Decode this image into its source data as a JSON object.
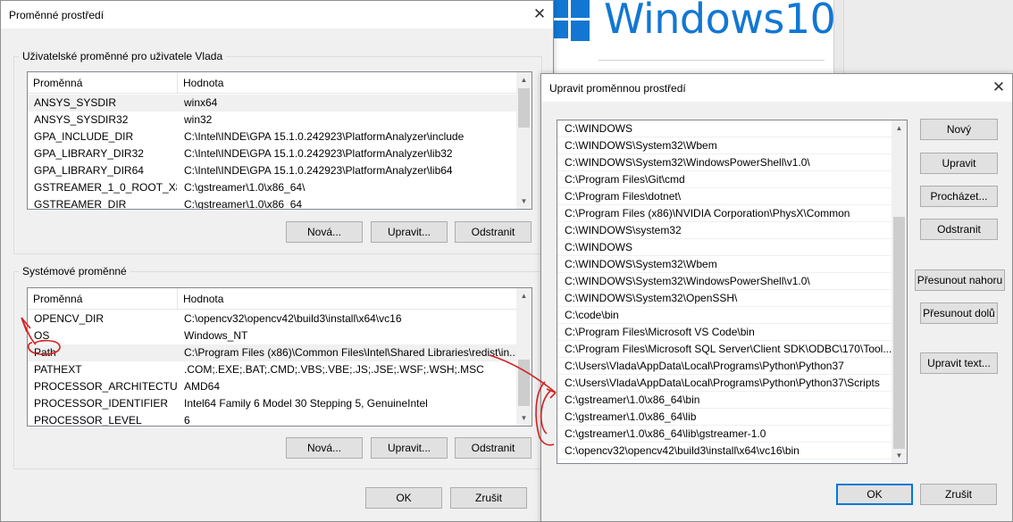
{
  "background": {
    "brand_text": "Windows",
    "brand_version": "10",
    "brand_color": "#1277d3"
  },
  "env_dialog": {
    "title": "Proměnné prostředí",
    "user_group_label": "Uživatelské proměnné pro uživatele Vlada",
    "user_columns": [
      "Proměnná",
      "Hodnota"
    ],
    "user_vars": [
      {
        "name": "ANSYS_SYSDIR",
        "value": "winx64"
      },
      {
        "name": "ANSYS_SYSDIR32",
        "value": "win32"
      },
      {
        "name": "GPA_INCLUDE_DIR",
        "value": "C:\\Intel\\INDE\\GPA 15.1.0.242923\\PlatformAnalyzer\\include"
      },
      {
        "name": "GPA_LIBRARY_DIR32",
        "value": "C:\\Intel\\INDE\\GPA 15.1.0.242923\\PlatformAnalyzer\\lib32"
      },
      {
        "name": "GPA_LIBRARY_DIR64",
        "value": "C:\\Intel\\INDE\\GPA 15.1.0.242923\\PlatformAnalyzer\\lib64"
      },
      {
        "name": "GSTREAMER_1_0_ROOT_X86...",
        "value": "C:\\gstreamer\\1.0\\x86_64\\"
      },
      {
        "name": "GSTREAMER_DIR",
        "value": "C:\\gstreamer\\1.0\\x86_64"
      }
    ],
    "user_buttons": {
      "new": "Nová...",
      "edit": "Upravit...",
      "delete": "Odstranit"
    },
    "system_group_label": "Systémové proměnné",
    "system_columns": [
      "Proměnná",
      "Hodnota"
    ],
    "system_vars": [
      {
        "name": "OPENCV_DIR",
        "value": "C:\\opencv32\\opencv42\\build3\\install\\x64\\vc16"
      },
      {
        "name": "OS",
        "value": "Windows_NT"
      },
      {
        "name": "Path",
        "value": "C:\\Program Files (x86)\\Common Files\\Intel\\Shared Libraries\\redist\\in..."
      },
      {
        "name": "PATHEXT",
        "value": ".COM;.EXE;.BAT;.CMD;.VBS;.VBE;.JS;.JSE;.WSF;.WSH;.MSC"
      },
      {
        "name": "PROCESSOR_ARCHITECTURE",
        "value": "AMD64"
      },
      {
        "name": "PROCESSOR_IDENTIFIER",
        "value": "Intel64 Family 6 Model 30 Stepping 5, GenuineIntel"
      },
      {
        "name": "PROCESSOR_LEVEL",
        "value": "6"
      }
    ],
    "system_buttons": {
      "new": "Nová...",
      "edit": "Upravit...",
      "delete": "Odstranit"
    },
    "ok": "OK",
    "cancel": "Zrušit"
  },
  "edit_dialog": {
    "title": "Upravit proměnnou prostředí",
    "entries": [
      "C:\\WINDOWS",
      "C:\\WINDOWS\\System32\\Wbem",
      "C:\\WINDOWS\\System32\\WindowsPowerShell\\v1.0\\",
      "C:\\Program Files\\Git\\cmd",
      "C:\\Program Files\\dotnet\\",
      "C:\\Program Files (x86)\\NVIDIA Corporation\\PhysX\\Common",
      "C:\\WINDOWS\\system32",
      "C:\\WINDOWS",
      "C:\\WINDOWS\\System32\\Wbem",
      "C:\\WINDOWS\\System32\\WindowsPowerShell\\v1.0\\",
      "C:\\WINDOWS\\System32\\OpenSSH\\",
      "C:\\code\\bin",
      "C:\\Program Files\\Microsoft VS Code\\bin",
      "C:\\Program Files\\Microsoft SQL Server\\Client SDK\\ODBC\\170\\Tool...",
      "C:\\Users\\Vlada\\AppData\\Local\\Programs\\Python\\Python37",
      "C:\\Users\\Vlada\\AppData\\Local\\Programs\\Python\\Python37\\Scripts",
      "C:\\gstreamer\\1.0\\x86_64\\bin",
      "C:\\gstreamer\\1.0\\x86_64\\lib",
      "C:\\gstreamer\\1.0\\x86_64\\lib\\gstreamer-1.0",
      "C:\\opencv32\\opencv42\\build3\\install\\x64\\vc16\\bin"
    ],
    "buttons": {
      "new": "Nový",
      "edit": "Upravit",
      "browse": "Procházet...",
      "delete": "Odstranit",
      "move_up": "Přesunout nahoru",
      "move_down": "Přesunout dolů",
      "edit_text": "Upravit text..."
    },
    "ok": "OK",
    "cancel": "Zrušit"
  },
  "annotation_color": "#d42020"
}
